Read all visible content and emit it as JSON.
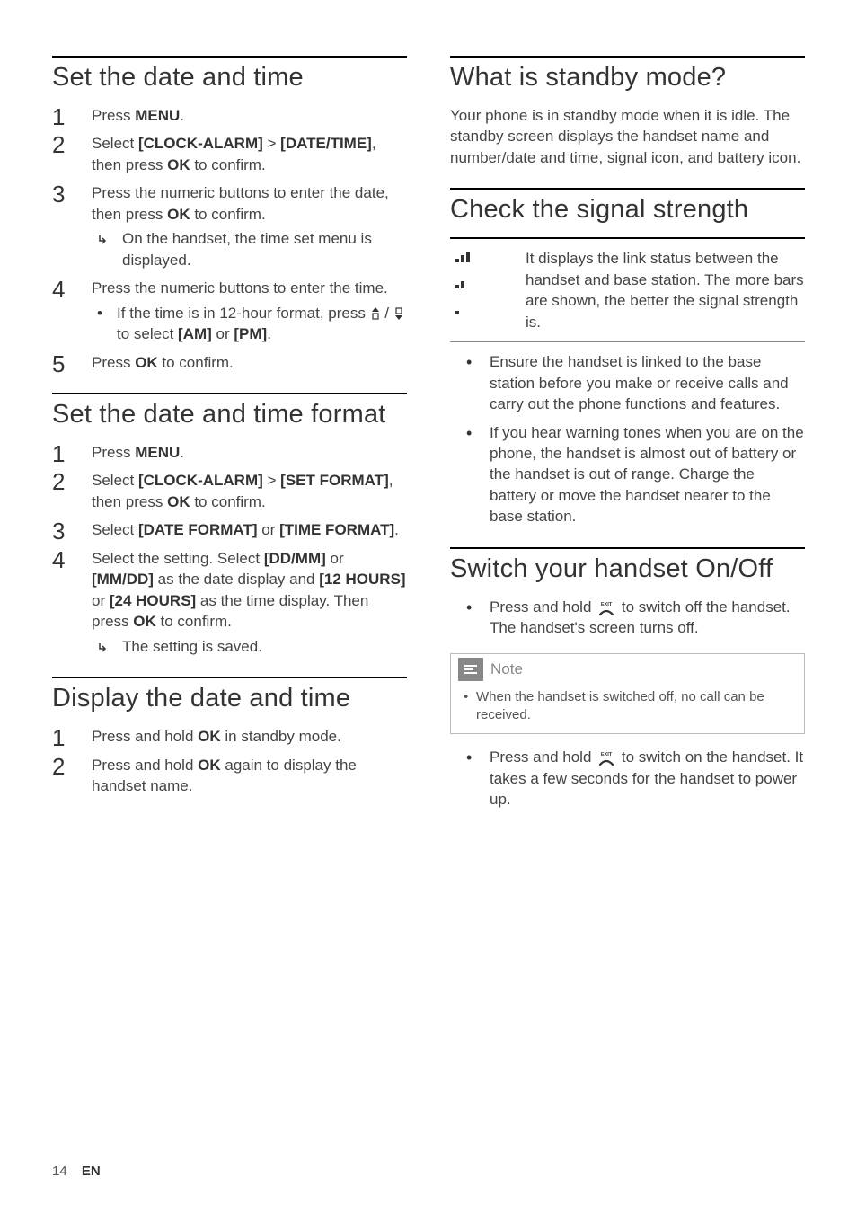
{
  "footer": {
    "page": "14",
    "lang": "EN"
  },
  "left": {
    "s1": {
      "title": "Set the date and time",
      "steps": [
        {
          "pre": "Press ",
          "b1": "MENU",
          "post": "."
        },
        {
          "pre": "Select ",
          "b1": "[CLOCK-ALARM]",
          "mid1": " > ",
          "b2": "[DATE/TIME]",
          "mid2": ", then press ",
          "b3": "OK",
          "post": " to confirm."
        },
        {
          "pre": "Press the numeric buttons to enter the date, then press ",
          "b1": "OK",
          "post": " to confirm.",
          "sub_arrow": "On the handset, the time set menu is displayed."
        },
        {
          "pre": "Press the numeric buttons to enter the time.",
          "sub_dot_pre": "If the time is in 12-hour format, press ",
          "sub_dot_mid": " to select ",
          "sub_dot_b1": "[AM]",
          "sub_dot_or": " or ",
          "sub_dot_b2": "[PM]",
          "sub_dot_post": "."
        },
        {
          "pre": "Press ",
          "b1": "OK",
          "post": " to confirm."
        }
      ]
    },
    "s2": {
      "title": "Set the date and time format",
      "steps": [
        {
          "pre": "Press ",
          "b1": "MENU",
          "post": "."
        },
        {
          "pre": "Select ",
          "b1": "[CLOCK-ALARM]",
          "mid1": " > ",
          "b2": "[SET FORMAT]",
          "mid2": ", then press ",
          "b3": "OK",
          "post": " to confirm."
        },
        {
          "pre": "Select ",
          "b1": "[DATE FORMAT]",
          "mid1": " or ",
          "b2": "[TIME FORMAT]",
          "post": "."
        },
        {
          "pre": "Select the setting. Select ",
          "b1": "[DD/MM]",
          "mid1": " or ",
          "b2": "[MM/DD]",
          "mid2": " as the date display and ",
          "b3": "[12 HOURS]",
          "mid3": " or ",
          "b4": "[24 HOURS]",
          "mid4": " as the time display. Then press ",
          "b5": "OK",
          "post": " to confirm.",
          "sub_arrow": "The setting is saved."
        }
      ]
    },
    "s3": {
      "title": "Display the date and time",
      "steps": [
        {
          "pre": "Press and hold ",
          "b1": "OK",
          "post": " in standby mode."
        },
        {
          "pre": "Press and hold ",
          "b1": "OK",
          "post": " again to display the handset name."
        }
      ]
    }
  },
  "right": {
    "s1": {
      "title": "What is standby mode?",
      "para": "Your phone is in standby mode when it is idle. The standby screen displays the handset name and number/date and time, signal icon, and battery icon."
    },
    "s2": {
      "title": "Check the signal strength",
      "desc": "It displays the link status between the handset and base station. The more bars are shown, the better the signal strength is.",
      "bullets": [
        "Ensure the handset is linked to the base station before you make or receive calls and carry out the phone functions and features.",
        "If you hear warning tones when you are on the phone, the handset is almost out of battery or the handset is out of range. Charge the battery or move the handset nearer to the base station."
      ]
    },
    "s3": {
      "title": "Switch your handset On/Off",
      "b1_pre": "Press and hold ",
      "b1_post": " to switch off the handset. The handset's screen turns off.",
      "note_label": "Note",
      "note_text": "When the handset is switched off, no call can be received.",
      "b2_pre": "Press and hold ",
      "b2_post": " to switch on the handset. It takes a few seconds for the handset to power up."
    }
  }
}
